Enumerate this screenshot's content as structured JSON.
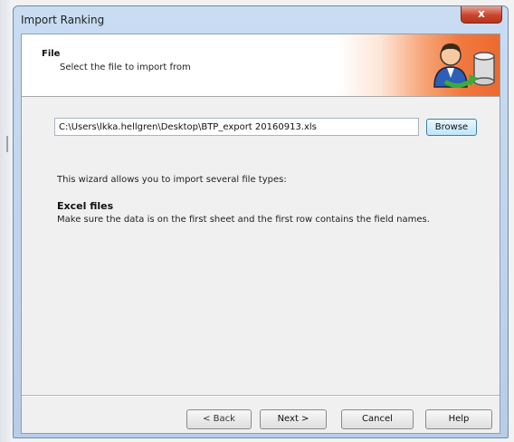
{
  "window": {
    "title": "Import Ranking",
    "close_glyph": "x"
  },
  "header": {
    "title": "File",
    "subtitle": "Select the file to import from",
    "icon": "import-database-icon"
  },
  "file": {
    "path": "C:\\Users\\lkka.hellgren\\Desktop\\BTP_export 20160913.xls",
    "browse_label": "Browse"
  },
  "body": {
    "intro": "This wizard allows you to import several file types:",
    "excel_heading": "Excel files",
    "excel_description": "Make sure the data is on the first sheet and the first row contains the field names."
  },
  "footer": {
    "back_label": "< Back",
    "next_label": "Next >",
    "cancel_label": "Cancel",
    "help_label": "Help"
  },
  "colors": {
    "header_accent": "#ec6a2e",
    "close_button": "#c8452d",
    "title_bar": "#c9dcf2"
  }
}
